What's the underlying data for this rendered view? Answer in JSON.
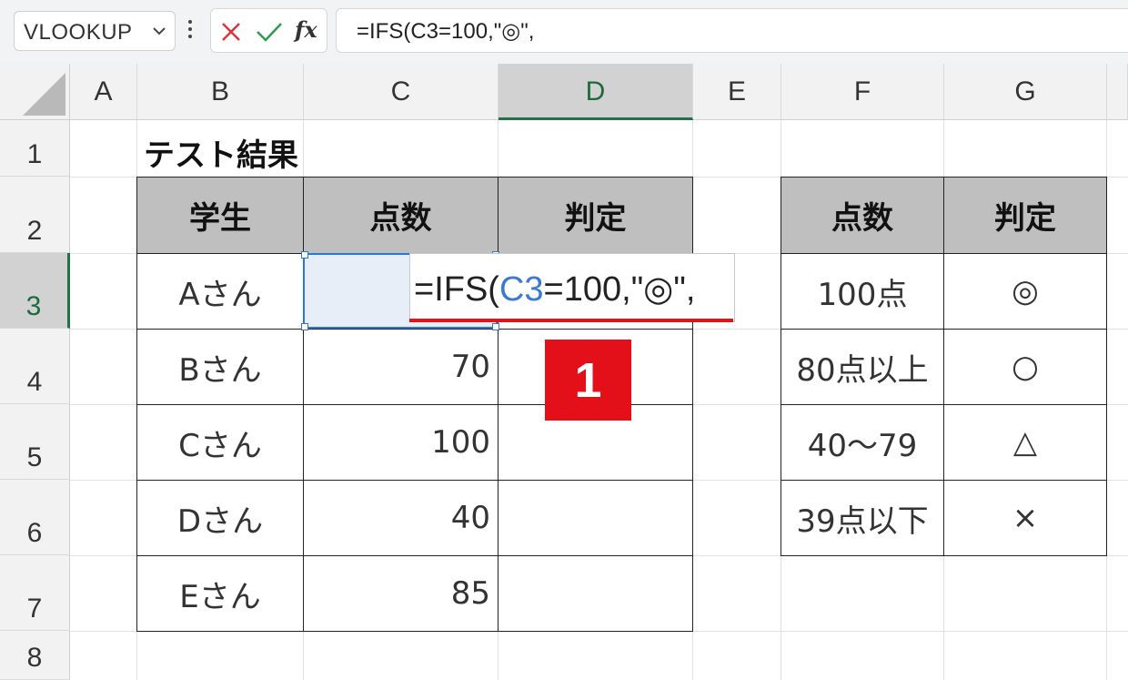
{
  "formula_bar": {
    "name_box": "VLOOKUP",
    "formula": "=IFS(C3=100,\"◎\","
  },
  "columns": [
    "A",
    "B",
    "C",
    "D",
    "E",
    "F",
    "G"
  ],
  "rows": [
    "1",
    "2",
    "3",
    "4",
    "5",
    "6",
    "7",
    "8"
  ],
  "active_column": "D",
  "active_row": "3",
  "sheet": {
    "title": "テスト結果",
    "main_table": {
      "headers": [
        "学生",
        "点数",
        "判定"
      ],
      "rows": [
        {
          "student": "Aさん",
          "score": ""
        },
        {
          "student": "Bさん",
          "score": "70"
        },
        {
          "student": "Cさん",
          "score": "100"
        },
        {
          "student": "Dさん",
          "score": "40"
        },
        {
          "student": "Eさん",
          "score": "85"
        }
      ]
    },
    "ref_table": {
      "headers": [
        "点数",
        "判定"
      ],
      "rows": [
        {
          "score": "100点",
          "grade": "◎"
        },
        {
          "score": "80点以上",
          "grade": "○"
        },
        {
          "score": "40〜79",
          "grade": "△"
        },
        {
          "score": "39点以下",
          "grade": "×"
        }
      ]
    },
    "editing": {
      "prefix": "=IFS(",
      "ref": "C3",
      "suffix": "=100,\"◎\","
    },
    "step_badge": "1"
  }
}
